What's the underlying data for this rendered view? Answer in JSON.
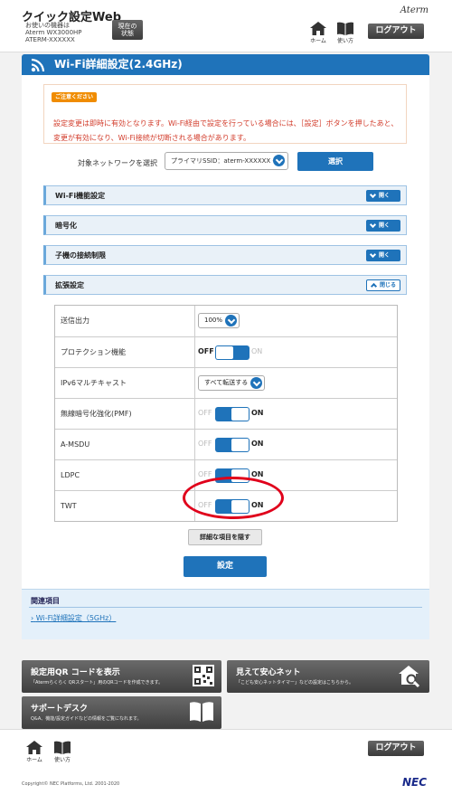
{
  "header": {
    "app_title": "クイック設定Web",
    "device_line1": "お使いの機器は",
    "device_line2": "Aterm WX3000HP",
    "device_line3": "ATERM-XXXXXX",
    "status_btn_line1": "現在の",
    "status_btn_line2": "状態",
    "brand": "Aterm",
    "home_label": "ホーム",
    "help_label": "使い方",
    "logout_label": "ログアウト"
  },
  "page": {
    "title": "Wi-Fi詳細設定(2.4GHz)"
  },
  "notice": {
    "badge": "ご注意ください",
    "text": "設定変更は即時に有効となります。Wi-Fi経由で設定を行っている場合には、［設定］ボタンを押したあと、変更が有効になり、Wi-Fi接続が切断される場合があります。"
  },
  "network_select": {
    "label": "対象ネットワークを選択",
    "value": "プライマリSSID：aterm-XXXXXX -g",
    "button": "選択"
  },
  "sections": [
    {
      "label": "Wi-Fi機能設定",
      "button": "開く"
    },
    {
      "label": "暗号化",
      "button": "開く"
    },
    {
      "label": "子機の接続制限",
      "button": "開く"
    },
    {
      "label": "拡張設定",
      "button": "閉じる"
    }
  ],
  "settings": [
    {
      "label": "送信出力",
      "value": "100%"
    },
    {
      "label": "プロテクション機能",
      "state": "OFF"
    },
    {
      "label": "IPv6マルチキャスト",
      "value": "すべて転送する"
    },
    {
      "label": "無線暗号化強化(PMF)",
      "state": "ON"
    },
    {
      "label": "A-MSDU",
      "state": "ON"
    },
    {
      "label": "LDPC",
      "state": "ON"
    },
    {
      "label": "TWT",
      "state": "ON"
    }
  ],
  "toggle_text": {
    "off": "OFF",
    "on": "ON"
  },
  "buttons": {
    "hide_details": "詳細な項目を隠す",
    "save": "設定"
  },
  "related": {
    "title": "関連項目",
    "link": "Wi-Fi詳細設定（5GHz）"
  },
  "cards": {
    "qr_title": "設定用QR コードを表示",
    "qr_desc": "「Atermらくらく QRスタート」用のQRコードを作成できます。",
    "safe_title": "見えて安心ネット",
    "safe_desc": "「こども安心ネットタイマー」などの設定はこちらから。",
    "support_title": "サポートデスク",
    "support_desc": "Q&A、機能/設定ガイドなどの情報をご覧になれます。"
  },
  "footer": {
    "home_label": "ホーム",
    "help_label": "使い方",
    "logout_label": "ログアウト",
    "copyright": "Copyright© NEC Platforms, Ltd. 2001-2020",
    "nec_logo": "NEC"
  },
  "colors": {
    "primary": "#1f73ba",
    "notice_red": "#d23b2a",
    "badge_orange": "#f08c00",
    "highlight_red": "#e0001b"
  }
}
